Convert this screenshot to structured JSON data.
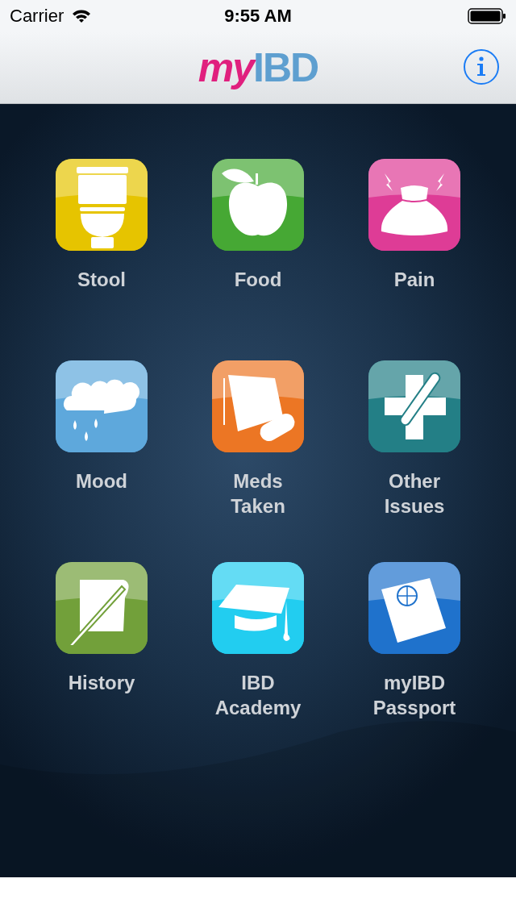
{
  "status_bar": {
    "carrier": "Carrier",
    "time": "9:55 AM"
  },
  "nav_bar": {
    "logo_prefix": "my",
    "logo_suffix": "IBD"
  },
  "tiles": [
    {
      "label": "Stool",
      "kind": "toilet",
      "color": "#e6c400"
    },
    {
      "label": "Food",
      "kind": "apple",
      "color": "#46a834"
    },
    {
      "label": "Pain",
      "kind": "icebag",
      "color": "#de3c96"
    },
    {
      "label": "Mood",
      "kind": "cloud",
      "color": "#5ea8dc"
    },
    {
      "label": "Meds Taken",
      "kind": "meds",
      "color": "#ec7624"
    },
    {
      "label": "Other Issues",
      "kind": "thermometer",
      "color": "#237f86"
    },
    {
      "label": "History",
      "kind": "scroll",
      "color": "#72a03a"
    },
    {
      "label": "IBD Academy",
      "kind": "cap",
      "color": "#22cdf0"
    },
    {
      "label": "myIBD Passport",
      "kind": "passport",
      "color": "#1f72cc"
    }
  ]
}
